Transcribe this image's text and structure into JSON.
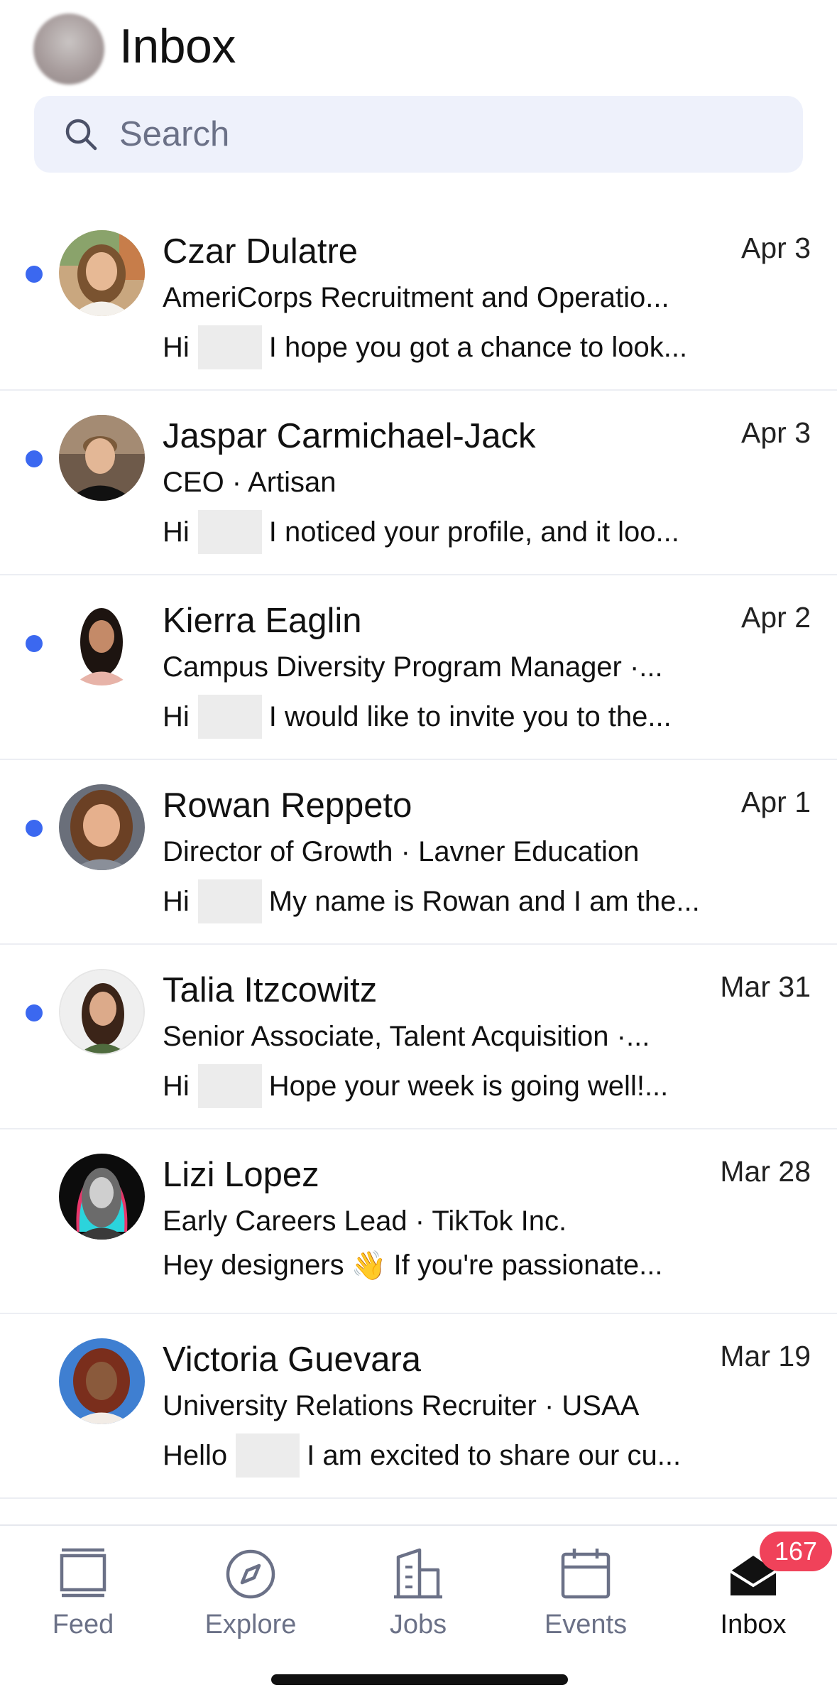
{
  "header": {
    "title": "Inbox"
  },
  "search": {
    "placeholder": "Search"
  },
  "colors": {
    "unread_dot": "#3b68f0",
    "badge": "#f0425a",
    "search_bg": "#eef1fb"
  },
  "messages": [
    {
      "name": "Czar Dulatre",
      "date": "Apr 3",
      "subtitle": "AmeriCorps Recruitment and Operatio...",
      "greeting": "Hi",
      "preview": "I hope you got a chance to look...",
      "unread": true
    },
    {
      "name": "Jaspar Carmichael-Jack",
      "date": "Apr 3",
      "subtitle": "CEO · Artisan",
      "greeting": "Hi",
      "preview": "I noticed your profile, and it loo...",
      "unread": true
    },
    {
      "name": "Kierra Eaglin",
      "date": "Apr 2",
      "subtitle": "Campus Diversity Program Manager ·...",
      "greeting": "Hi",
      "preview": "I would like to invite you to the...",
      "unread": true
    },
    {
      "name": "Rowan Reppeto",
      "date": "Apr 1",
      "subtitle": "Director of Growth · Lavner Education",
      "greeting": "Hi",
      "preview": "My name is Rowan and I am the...",
      "unread": true
    },
    {
      "name": "Talia Itzcowitz",
      "date": "Mar 31",
      "subtitle": "Senior Associate, Talent Acquisition ·...",
      "greeting": "Hi",
      "preview": "Hope your week is going well!...",
      "unread": true
    },
    {
      "name": "Lizi Lopez",
      "date": "Mar 28",
      "subtitle": "Early Careers Lead · TikTok Inc.",
      "greeting": "Hey designers",
      "emoji": "👋",
      "preview": "If you're passionate...",
      "unread": false
    },
    {
      "name": "Victoria Guevara",
      "date": "Mar 19",
      "subtitle": "University Relations Recruiter · USAA",
      "greeting": "Hello",
      "preview": "I am excited to share our cu...",
      "unread": false
    }
  ],
  "tabs": [
    {
      "label": "Feed",
      "icon": "feed-icon"
    },
    {
      "label": "Explore",
      "icon": "compass-icon"
    },
    {
      "label": "Jobs",
      "icon": "building-icon"
    },
    {
      "label": "Events",
      "icon": "calendar-icon"
    },
    {
      "label": "Inbox",
      "icon": "inbox-icon",
      "active": true,
      "badge": "167"
    }
  ]
}
